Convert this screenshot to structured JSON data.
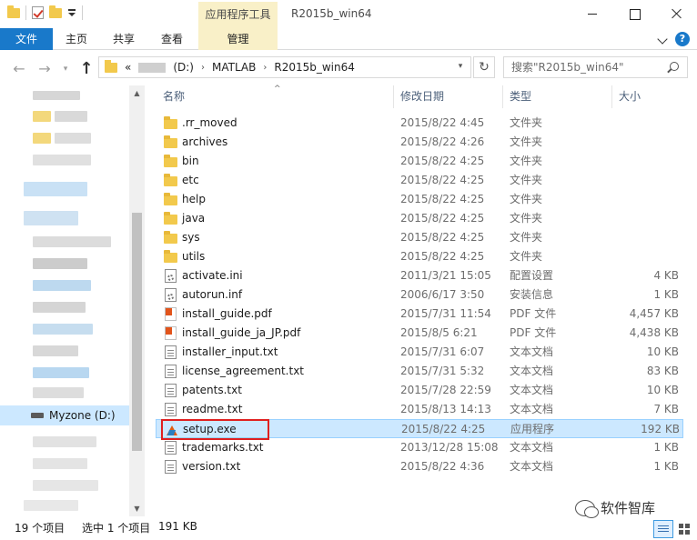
{
  "titlebar": {
    "contextual_tab_title": "应用程序工具",
    "window_title": "R2015b_win64"
  },
  "ribbon": {
    "tabs": [
      {
        "label": "文件"
      },
      {
        "label": "主页"
      },
      {
        "label": "共享"
      },
      {
        "label": "查看"
      },
      {
        "label": "管理"
      }
    ],
    "help_label": "?"
  },
  "address": {
    "overflow": "«",
    "segments": [
      "(D:)",
      "MATLAB",
      "R2015b_win64"
    ],
    "separator": "›"
  },
  "search": {
    "placeholder": "搜索\"R2015b_win64\""
  },
  "navpane": {
    "drive_label": "Myzone (D:)"
  },
  "columns": {
    "name": "名称",
    "date": "修改日期",
    "type": "类型",
    "size": "大小"
  },
  "files": [
    {
      "name": ".rr_moved",
      "date": "2015/8/22 4:45",
      "type": "文件夹",
      "size": "",
      "icon": "folder-icon"
    },
    {
      "name": "archives",
      "date": "2015/8/22 4:26",
      "type": "文件夹",
      "size": "",
      "icon": "folder-icon"
    },
    {
      "name": "bin",
      "date": "2015/8/22 4:25",
      "type": "文件夹",
      "size": "",
      "icon": "folder-icon"
    },
    {
      "name": "etc",
      "date": "2015/8/22 4:25",
      "type": "文件夹",
      "size": "",
      "icon": "folder-icon"
    },
    {
      "name": "help",
      "date": "2015/8/22 4:25",
      "type": "文件夹",
      "size": "",
      "icon": "folder-icon"
    },
    {
      "name": "java",
      "date": "2015/8/22 4:25",
      "type": "文件夹",
      "size": "",
      "icon": "folder-icon"
    },
    {
      "name": "sys",
      "date": "2015/8/22 4:25",
      "type": "文件夹",
      "size": "",
      "icon": "folder-icon"
    },
    {
      "name": "utils",
      "date": "2015/8/22 4:25",
      "type": "文件夹",
      "size": "",
      "icon": "folder-icon"
    },
    {
      "name": "activate.ini",
      "date": "2011/3/21 15:05",
      "type": "配置设置",
      "size": "4 KB",
      "icon": "config-file-icon"
    },
    {
      "name": "autorun.inf",
      "date": "2006/6/17 3:50",
      "type": "安装信息",
      "size": "1 KB",
      "icon": "config-file-icon"
    },
    {
      "name": "install_guide.pdf",
      "date": "2015/7/31 11:54",
      "type": "PDF 文件",
      "size": "4,457 KB",
      "icon": "pdf-icon"
    },
    {
      "name": "install_guide_ja_JP.pdf",
      "date": "2015/8/5 6:21",
      "type": "PDF 文件",
      "size": "4,438 KB",
      "icon": "pdf-icon"
    },
    {
      "name": "installer_input.txt",
      "date": "2015/7/31 6:07",
      "type": "文本文档",
      "size": "10 KB",
      "icon": "text-file-icon"
    },
    {
      "name": "license_agreement.txt",
      "date": "2015/7/31 5:32",
      "type": "文本文档",
      "size": "83 KB",
      "icon": "text-file-icon"
    },
    {
      "name": "patents.txt",
      "date": "2015/7/28 22:59",
      "type": "文本文档",
      "size": "10 KB",
      "icon": "text-file-icon"
    },
    {
      "name": "readme.txt",
      "date": "2015/8/13 14:13",
      "type": "文本文档",
      "size": "7 KB",
      "icon": "text-file-icon"
    },
    {
      "name": "setup.exe",
      "date": "2015/8/22 4:25",
      "type": "应用程序",
      "size": "192 KB",
      "icon": "matlab-icon",
      "selected": true
    },
    {
      "name": "trademarks.txt",
      "date": "2013/12/28 15:08",
      "type": "文本文档",
      "size": "1 KB",
      "icon": "text-file-icon"
    },
    {
      "name": "version.txt",
      "date": "2015/8/22 4:36",
      "type": "文本文档",
      "size": "1 KB",
      "icon": "text-file-icon"
    }
  ],
  "status": {
    "item_count": "19 个项目",
    "selected": "选中 1 个项目",
    "selected_size": "191 KB"
  },
  "watermark": {
    "text": "软件智库"
  },
  "colors": {
    "accent": "#1979ca",
    "selection": "#cce8ff",
    "contextual_tab": "#f9f0c8",
    "highlight_border": "#e02020"
  }
}
